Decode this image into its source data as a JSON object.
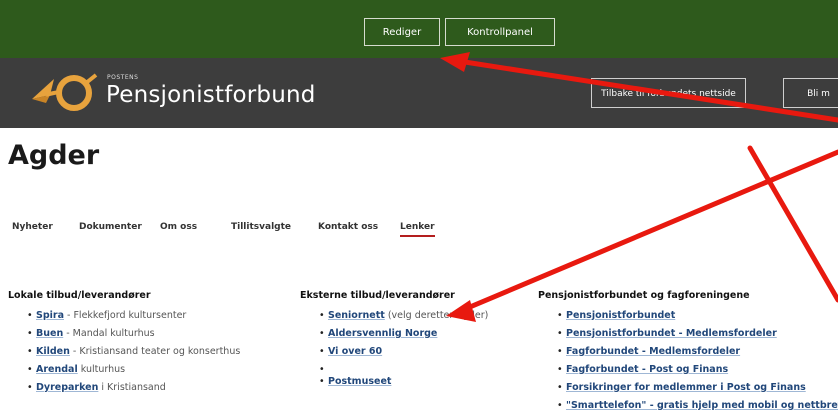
{
  "adminbar": {
    "edit_label": "Rediger",
    "panel_label": "Kontrollpanel"
  },
  "brand": {
    "small": "POSTENS",
    "name": "Pensjonistforbund"
  },
  "header": {
    "back_label": "Tilbake til forbundets nettside",
    "join_label": "Bli m"
  },
  "page": {
    "title": "Agder"
  },
  "tabs": [
    "Nyheter",
    "Dokumenter",
    "Om oss",
    "Tillitsvalgte",
    "Kontakt oss",
    "Lenker"
  ],
  "columns": [
    {
      "heading": "Lokale tilbud/leverandører",
      "items": [
        {
          "link": "Spira",
          "rest": " - Flekkefjord kultursenter"
        },
        {
          "link": "Buen",
          "rest": " - Mandal kulturhus"
        },
        {
          "link": "Kilden",
          "rest": " - Kristiansand teater og konserthus"
        },
        {
          "link": "Arendal",
          "rest": " kulturhus"
        },
        {
          "link": "Dyreparken",
          "rest": " i Kristiansand"
        }
      ]
    },
    {
      "heading": "Eksterne tilbud/leverandører",
      "items": [
        {
          "link": "Seniornett",
          "rest": " (velg deretter Agder)"
        },
        {
          "link": "Aldersvennlig Norge",
          "rest": ""
        },
        {
          "link": "Vi over 60",
          "rest": ""
        },
        {
          "link": "Postmuseet",
          "rest": ""
        }
      ]
    },
    {
      "heading": "Pensjonistforbundet og fagforeningene",
      "items": [
        {
          "link": "Pensjonistforbundet",
          "rest": ""
        },
        {
          "link": "Pensjonistforbundet - Medlemsfordeler",
          "rest": ""
        },
        {
          "link": "Fagforbundet - Medlemsfordeler",
          "rest": ""
        },
        {
          "link": "Fagforbundet - Post og Finans",
          "rest": ""
        },
        {
          "link": "Forsikringer for medlemmer i Post og Finans",
          "rest": ""
        },
        {
          "link": "\"Smarttelefon\" - gratis hjelp med mobil og nettbrett",
          "rest": ""
        }
      ]
    }
  ],
  "colors": {
    "adminbar": "#2e5a1c",
    "header": "#3d3d3d",
    "accent": "#b41e1e",
    "link": "#21477a",
    "logo": "#e8a33d",
    "annotation_arrow": "#e8190f"
  },
  "icons": {
    "logo": "posthorn-logo-icon"
  }
}
